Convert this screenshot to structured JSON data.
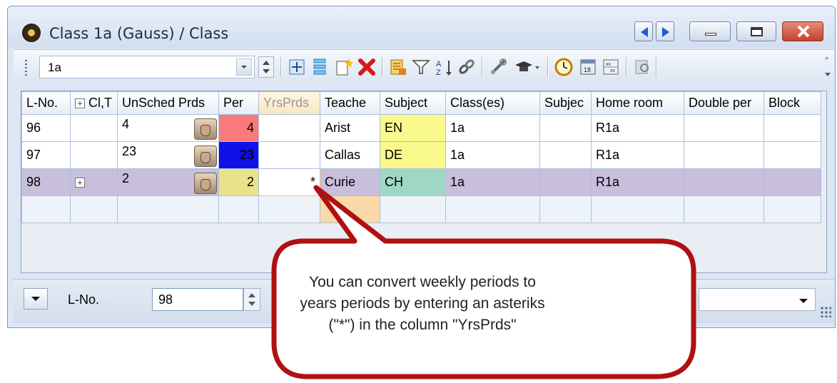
{
  "window": {
    "title": "Class 1a (Gauss) / Class"
  },
  "toolbar": {
    "class_value": "1a",
    "icons": [
      "add-row-icon",
      "list-icon",
      "new-icon",
      "delete-icon",
      "assign-icon",
      "filter-icon",
      "sort-icon",
      "link-icon",
      "tools-icon",
      "teacher-icon",
      "clock-icon",
      "calendar-icon",
      "grid-icon",
      "print-icon"
    ]
  },
  "grid": {
    "columns": [
      "L-No.",
      "Cl,T",
      "UnSched Prds",
      "Per",
      "YrsPrds",
      "Teache",
      "Subject",
      "Class(es)",
      "Subjec",
      "Home room",
      "Double per",
      "Block"
    ],
    "rows": [
      {
        "lno": "96",
        "clt": "",
        "unsched": "4",
        "per": "4",
        "yrs": "",
        "teacher": "Arist",
        "subject": "EN",
        "classes": "1a",
        "subjroom": "",
        "homeroom": "R1a",
        "double": "",
        "block": ""
      },
      {
        "lno": "97",
        "clt": "",
        "unsched": "23",
        "per": "23",
        "yrs": "",
        "teacher": "Callas",
        "subject": "DE",
        "classes": "1a",
        "subjroom": "",
        "homeroom": "R1a",
        "double": "",
        "block": ""
      },
      {
        "lno": "98",
        "clt": "+",
        "unsched": "2",
        "per": "2",
        "yrs": "*",
        "teacher": "Curie",
        "subject": "CH",
        "classes": "1a",
        "subjroom": "",
        "homeroom": "R1a",
        "double": "",
        "block": ""
      }
    ],
    "colors": {
      "per_row1": "#f97a7a",
      "per_row2": "#1010e8",
      "per_row3": "#e9e28a",
      "subject_en": "#fafa8c",
      "subject_de": "#fafa8c",
      "subject_ch": "#9ed8c4",
      "selected_row": "#c8bfdd"
    }
  },
  "statusbar": {
    "label": "L-No.",
    "value": "98"
  },
  "callout": {
    "text": "You can convert weekly periods to years periods by entering an asteriks (\"*\") in the column \"YrsPrds\"",
    "border_color": "#b01010"
  }
}
